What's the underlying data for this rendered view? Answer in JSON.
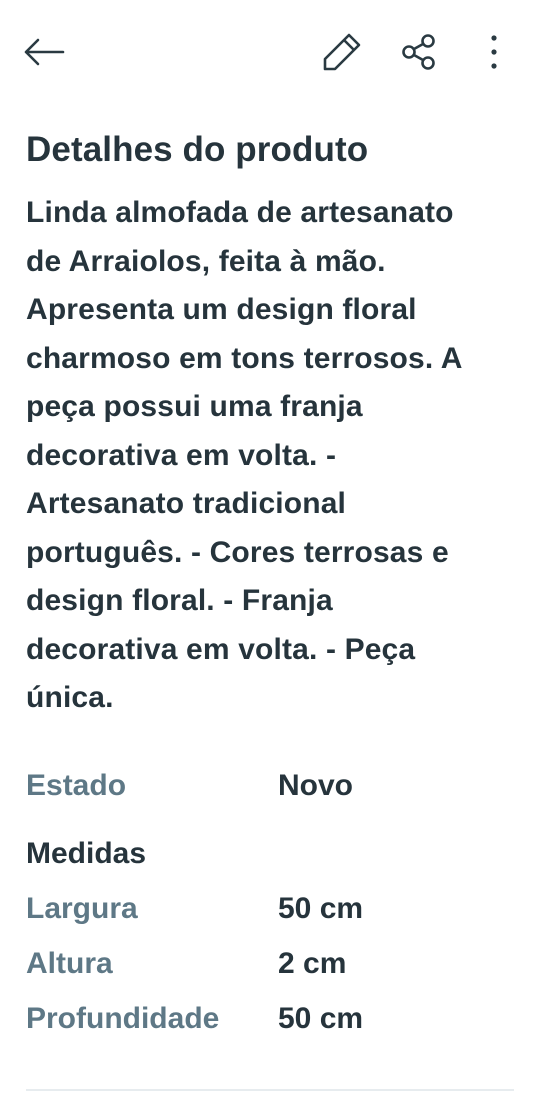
{
  "header": {
    "back_icon": "arrow-left-icon",
    "edit_icon": "pencil-icon",
    "share_icon": "share-icon",
    "more_icon": "more-vertical-icon",
    "icon_color": "#2a3a42"
  },
  "product": {
    "section_title": "Detalhes do produto",
    "description": "Linda almofada de artesanato\nde Arraiolos, feita à mão.\nApresenta um design floral\ncharmoso em tons terrosos.  A\npeça possui uma franja\ndecorativa em volta.  -\nArtesanato tradicional\nportuguês. - Cores terrosas e\ndesign floral. - Franja\ndecorativa em volta. - Peça\núnica."
  },
  "details": {
    "state_label": "Estado",
    "state_value": "Novo",
    "measures_heading": "Medidas",
    "width_label": "Largura",
    "width_value": "50 cm",
    "height_label": "Altura",
    "height_value": "2 cm",
    "depth_label": "Profundidade",
    "depth_value": "50 cm"
  },
  "colors": {
    "text_primary": "#26343c",
    "text_label": "#5e7886",
    "divider": "#e7ecef"
  }
}
